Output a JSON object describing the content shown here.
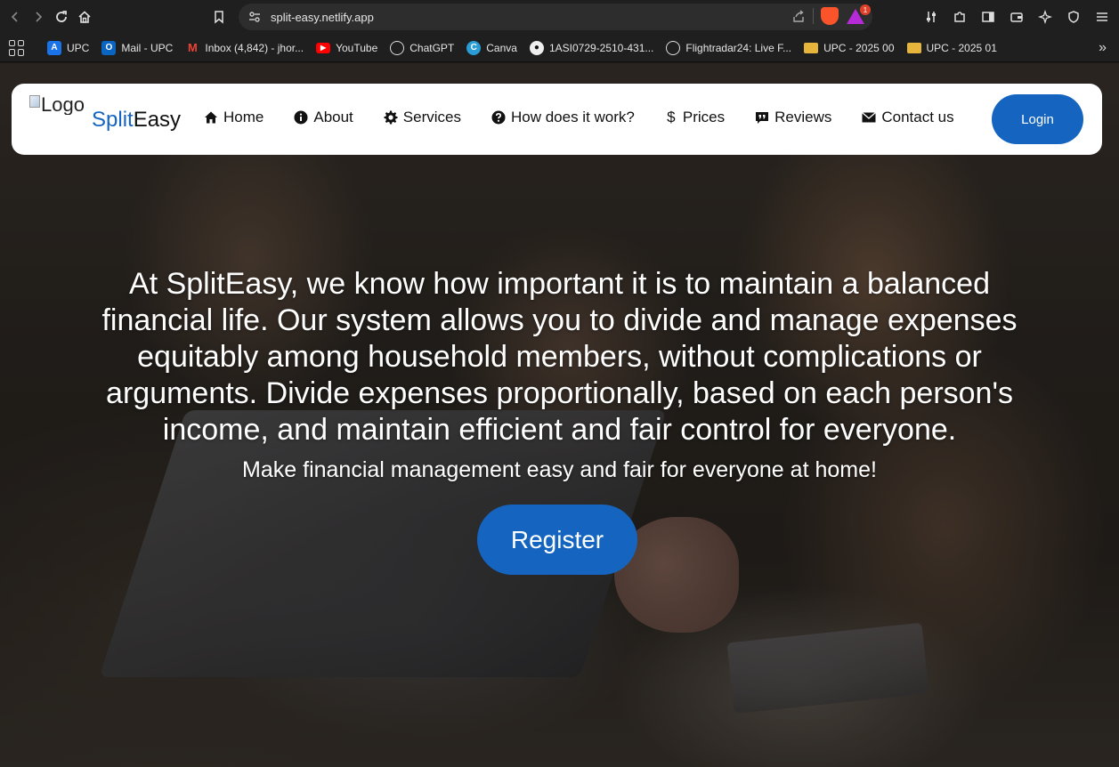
{
  "browser": {
    "url": "split-easy.netlify.app",
    "rewards_badge": "1",
    "bookmarks": [
      {
        "label": "UPC",
        "icon": "upc-icon",
        "color": "#1a73e8"
      },
      {
        "label": "Mail - UPC",
        "icon": "outlook-icon",
        "color": "#0a64c2"
      },
      {
        "label": "Inbox (4,842) - jhor...",
        "icon": "gmail-icon",
        "color": "#ea4335"
      },
      {
        "label": "YouTube",
        "icon": "youtube-icon",
        "color": "#ff0000"
      },
      {
        "label": "ChatGPT",
        "icon": "chatgpt-icon",
        "color": "#444444"
      },
      {
        "label": "Canva",
        "icon": "canva-icon",
        "color": "#2a9dd6"
      },
      {
        "label": "1ASI0729-2510-431...",
        "icon": "github-icon",
        "color": "#222222"
      },
      {
        "label": "Flightradar24: Live F...",
        "icon": "flightradar-icon",
        "color": "#333333"
      },
      {
        "label": "UPC - 2025 00",
        "icon": "folder-icon",
        "color": "#e7b53b"
      },
      {
        "label": "UPC - 2025 01",
        "icon": "folder-icon",
        "color": "#e7b53b"
      }
    ]
  },
  "nav": {
    "logo_alt": "Logo",
    "brand_split": "Split",
    "brand_easy": "Easy",
    "items": [
      {
        "label": "Home",
        "icon": "home-icon"
      },
      {
        "label": "About",
        "icon": "info-icon"
      },
      {
        "label": "Services",
        "icon": "gear-icon"
      },
      {
        "label": "How does it work?",
        "icon": "question-icon"
      },
      {
        "label": "Prices",
        "icon": "dollar-icon"
      },
      {
        "label": "Reviews",
        "icon": "quote-icon"
      },
      {
        "label": "Contact us",
        "icon": "envelope-icon"
      }
    ],
    "login_label": "Login"
  },
  "hero": {
    "text": "At SplitEasy, we know how important it is to maintain a balanced financial life. Our system allows you to divide and manage expenses equitably among household members, without complications or arguments. Divide expenses proportionally, based on each person's income, and maintain efficient and fair control for everyone.",
    "subtitle": "Make financial management easy and fair for everyone at home!",
    "register_label": "Register"
  },
  "colors": {
    "primary": "#1565c0",
    "nav_bg": "#ffffff",
    "chrome_bg": "#1f1f1f"
  }
}
